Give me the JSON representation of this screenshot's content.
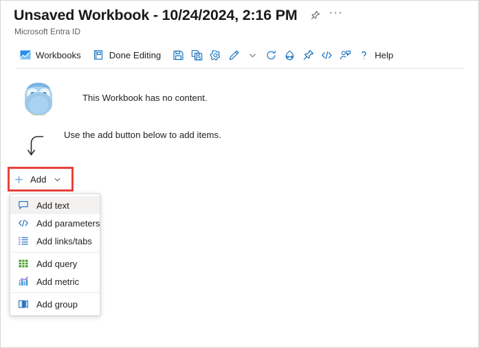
{
  "window": {
    "background": "#ffffff",
    "border_color": "#d6d6d6"
  },
  "header": {
    "title": "Unsaved Workbook - 10/24/2024, 2:16 PM",
    "subtitle": "Microsoft Entra ID",
    "pin_icon": "pin-icon",
    "more_icon": "ellipsis-icon",
    "more_label": "···"
  },
  "toolbar": {
    "accent": "#0f6cbd",
    "items": [
      {
        "name": "workbooks",
        "label": "Workbooks",
        "icon": "workbooks-chart-icon",
        "has_label": true
      },
      {
        "name": "done-editing",
        "label": "Done Editing",
        "icon": "done-editing-icon",
        "has_label": true
      },
      {
        "name": "save",
        "label": "",
        "icon": "save-icon",
        "has_label": false
      },
      {
        "name": "save-as",
        "label": "",
        "icon": "save-as-icon",
        "has_label": false
      },
      {
        "name": "settings",
        "label": "",
        "icon": "gear-icon",
        "has_label": false
      },
      {
        "name": "edit",
        "label": "",
        "icon": "pencil-icon",
        "has_label": false
      },
      {
        "name": "edit-chevron",
        "label": "",
        "icon": "chevron-down-icon",
        "has_label": false
      },
      {
        "name": "refresh",
        "label": "",
        "icon": "refresh-icon",
        "has_label": false
      },
      {
        "name": "auto-refresh",
        "label": "",
        "icon": "clock-auto-refresh-icon",
        "has_label": false
      },
      {
        "name": "pin",
        "label": "",
        "icon": "pin-icon",
        "has_label": false
      },
      {
        "name": "code",
        "label": "",
        "icon": "code-brackets-icon",
        "has_label": false
      },
      {
        "name": "share",
        "label": "",
        "icon": "share-person-icon",
        "has_label": false
      },
      {
        "name": "help",
        "label": "Help",
        "icon": "question-mark-icon",
        "has_label": true
      }
    ]
  },
  "content": {
    "empty_message": "This Workbook has no content.",
    "hint_message": "Use the add button below to add items.",
    "owl_icon": "owl-illustration-icon",
    "arrow_icon": "curved-down-arrow-icon"
  },
  "add_button": {
    "label": "Add",
    "plus_icon": "plus-icon",
    "chevron_icon": "chevron-down-icon",
    "highlight_color": "#e8413a"
  },
  "menu": {
    "groups": [
      {
        "items": [
          {
            "label": "Add text",
            "icon": "text-comment-icon",
            "hovered": true
          },
          {
            "label": "Add parameters",
            "icon": "code-brackets-icon",
            "hovered": false
          },
          {
            "label": "Add links/tabs",
            "icon": "list-links-icon",
            "hovered": false
          }
        ]
      },
      {
        "items": [
          {
            "label": "Add query",
            "icon": "grid-query-icon",
            "hovered": false
          },
          {
            "label": "Add metric",
            "icon": "bar-chart-metric-icon",
            "hovered": false
          }
        ]
      },
      {
        "items": [
          {
            "label": "Add group",
            "icon": "group-columns-icon",
            "hovered": false
          }
        ]
      }
    ]
  }
}
